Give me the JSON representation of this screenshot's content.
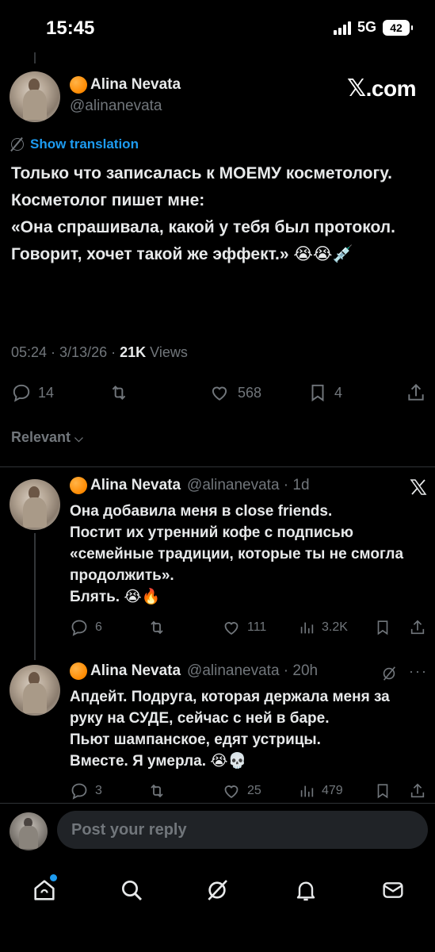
{
  "status": {
    "time": "15:45",
    "network": "5G",
    "battery": "42"
  },
  "post": {
    "author_name": "Alina Nevata",
    "handle": "@alinanevata",
    "brand": {
      "x": "𝕏",
      "suffix": ".com"
    },
    "show_translation": "Show translation",
    "body": "Только что записалась к МОЕМУ косметологу.\nКосметолог пишет мне:\n«Она спрашивала, какой у тебя был протокол. Говорит, хочет такой же эффект.» 😭😭💉",
    "time": "05:24",
    "date": "3/13/26",
    "views_count": "21K",
    "views_label": "Views",
    "replies": "14",
    "reposts": "",
    "likes": "568",
    "bookmarks": "4"
  },
  "sort": {
    "label": "Relevant",
    "chevron": "⌵"
  },
  "replies": [
    {
      "author_name": "Alina Nevata",
      "meta": "@alinanevata · 1d",
      "body": "Она добавила меня в close friends.\nПостит их утренний кофе с подписью «семейные традиции, которые ты не смогла продолжить».\nБлять. 😭🔥",
      "replies": "6",
      "likes": "111",
      "views": "3.2K"
    },
    {
      "author_name": "Alina Nevata",
      "meta": "@alinanevata · 20h",
      "body": "Апдейт. Подруга, которая держала меня за руку на СУДЕ, сейчас с ней в баре.\nПьют шампанское, едят устрицы.\nВместе. Я умерла. 😭💀",
      "replies": "3",
      "likes": "25",
      "views": "479"
    }
  ],
  "composer": {
    "placeholder": "Post your reply"
  },
  "colors": {
    "accent": "#1d9bf0",
    "muted": "#71767b",
    "background": "#000000"
  },
  "icons": [
    "reply-icon",
    "repost-icon",
    "like-icon",
    "bookmark-icon",
    "share-icon",
    "views-icon",
    "home-icon",
    "search-icon",
    "grok-icon",
    "notifications-icon",
    "messages-icon"
  ]
}
